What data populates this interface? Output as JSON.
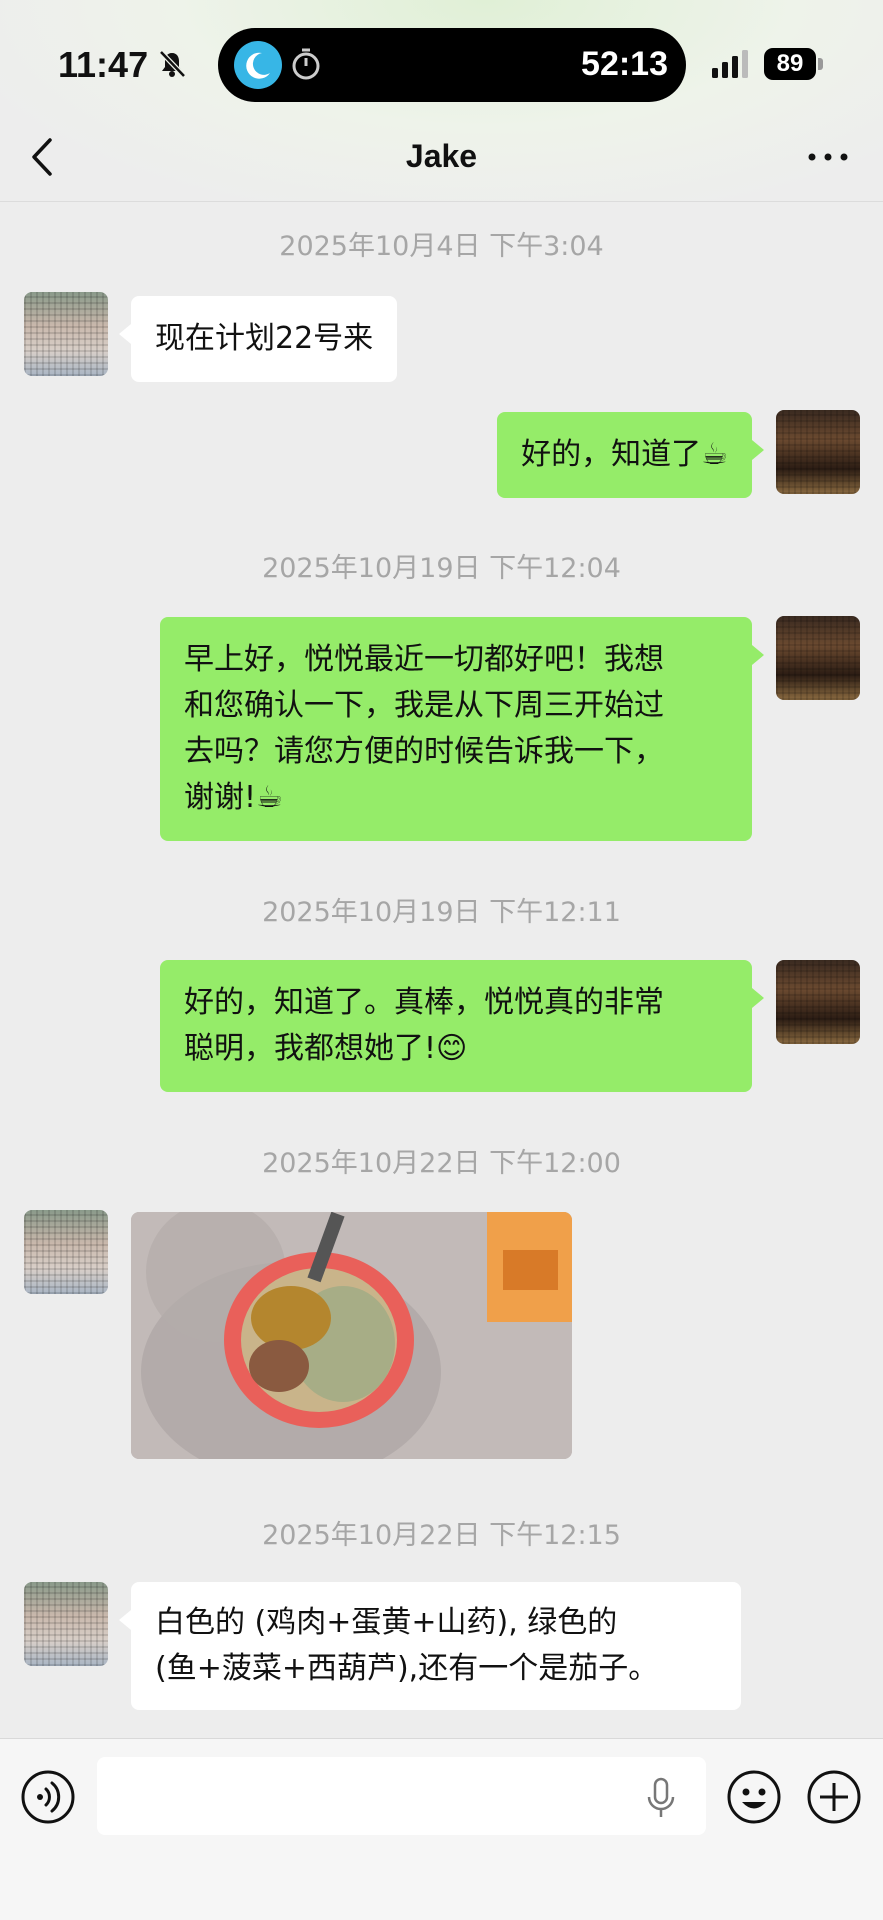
{
  "status_bar": {
    "time": "11:47",
    "timer": "52:13",
    "battery": "89"
  },
  "header": {
    "title": "Jake"
  },
  "messages": [
    {
      "type": "timestamp",
      "text": "2025年10月4日 下午3:04"
    },
    {
      "type": "text",
      "from": "peer",
      "text": "现在计划22号来"
    },
    {
      "type": "text",
      "from": "me",
      "text": "好的，知道了☕"
    },
    {
      "type": "timestamp",
      "text": "2025年10月19日 下午12:04"
    },
    {
      "type": "text",
      "from": "me",
      "lines": [
        "早上好，悦悦最近一切都好吧！我想",
        "和您确认一下，我是从下周三开始过",
        "去吗？请您方便的时候告诉我一下，",
        "谢谢!☕"
      ]
    },
    {
      "type": "timestamp",
      "text": "2025年10月19日 下午12:11"
    },
    {
      "type": "text",
      "from": "me",
      "lines": [
        "好的，知道了。真棒，悦悦真的非常",
        "聪明，我都想她了!😊"
      ]
    },
    {
      "type": "timestamp",
      "text": "2025年10月22日 下午12:00"
    },
    {
      "type": "image",
      "from": "peer"
    },
    {
      "type": "timestamp",
      "text": "2025年10月22日 下午12:15"
    },
    {
      "type": "text",
      "from": "peer",
      "lines": [
        "白色的 (鸡肉+蛋黄+山药), 绿色的",
        "(鱼+菠菜+西葫芦),还有一个是茄子。"
      ]
    }
  ],
  "colors": {
    "my_bubble": "#95ec69",
    "peer_bubble": "#ffffff",
    "background": "#ededed",
    "timestamp": "#a6a6a6"
  },
  "input": {
    "value": "",
    "placeholder": ""
  }
}
